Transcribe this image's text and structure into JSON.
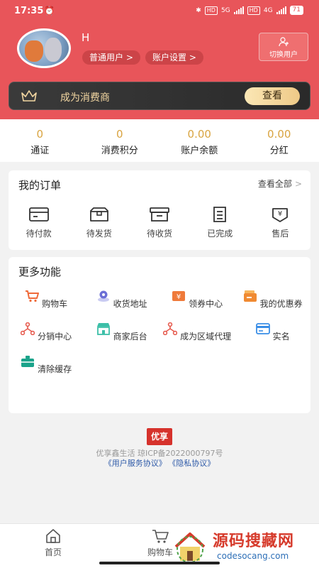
{
  "status_bar": {
    "time": "17:35",
    "hd1": "HD",
    "net1": "5G",
    "hd2": "HD",
    "net2": "4G",
    "battery": "71"
  },
  "profile": {
    "username": "H",
    "user_type": "普通用户 >",
    "account_settings": "账户设置 >",
    "switch_user": "切换用户"
  },
  "vip": {
    "text": "成为消费商",
    "button": "查看"
  },
  "stats": [
    {
      "value": "0",
      "label": "通证"
    },
    {
      "value": "0",
      "label": "消费积分"
    },
    {
      "value": "0.00",
      "label": "账户余额"
    },
    {
      "value": "0.00",
      "label": "分红"
    }
  ],
  "orders": {
    "title": "我的订单",
    "view_all": "查看全部",
    "chevron": ">",
    "items": [
      {
        "label": "待付款",
        "icon": "wallet-icon"
      },
      {
        "label": "待发货",
        "icon": "package-icon"
      },
      {
        "label": "待收货",
        "icon": "inbox-icon"
      },
      {
        "label": "已完成",
        "icon": "list-icon"
      },
      {
        "label": "售后",
        "icon": "after-sales-icon"
      }
    ]
  },
  "functions": {
    "title": "更多功能",
    "items": [
      {
        "label": "购物车",
        "icon": "cart-icon",
        "color": "#ef6a3a"
      },
      {
        "label": "收货地址",
        "icon": "location-icon",
        "color": "#6b6fd6"
      },
      {
        "label": "领券中心",
        "icon": "coupon-center-icon",
        "color": "#ef7a3a"
      },
      {
        "label": "我的优惠券",
        "icon": "my-coupon-icon",
        "color": "#f08a32"
      },
      {
        "label": "分销中心",
        "icon": "distribution-icon",
        "color": "#e65b4f"
      },
      {
        "label": "商家后台",
        "icon": "store-icon",
        "color": "#3cbfa8"
      },
      {
        "label": "成为区域代理",
        "icon": "regional-agent-icon",
        "color": "#e65b4f"
      },
      {
        "label": "实名",
        "icon": "id-card-icon",
        "color": "#3a8ee6"
      },
      {
        "label": "清除缓存",
        "icon": "clear-cache-icon",
        "color": "#1aa38a"
      }
    ]
  },
  "footer": {
    "logo_text": "优享",
    "line": "优享鑫生活 琼ICP备2022000797号",
    "link_user": "《用户服务协议》",
    "link_privacy": "《隐私协议》"
  },
  "tabbar": {
    "home": "首页",
    "cart": "购物车"
  },
  "watermark": {
    "title": "源码搜藏网",
    "url": "codesocang.com"
  },
  "colors": {
    "header": "#e8555a",
    "accent_gold": "#d9a441",
    "link": "#2e5aa8"
  }
}
